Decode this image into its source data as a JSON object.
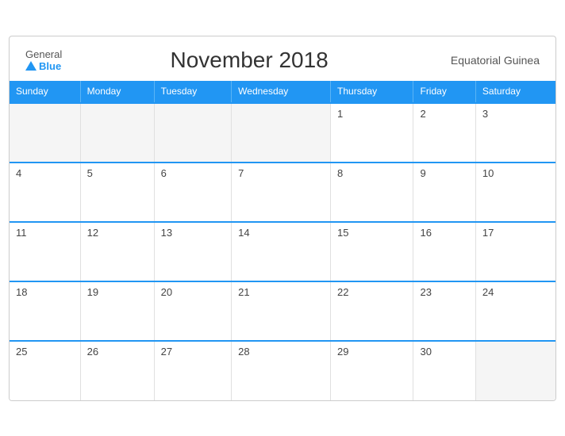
{
  "header": {
    "logo_general": "General",
    "logo_blue": "Blue",
    "title": "November 2018",
    "country": "Equatorial Guinea"
  },
  "days_of_week": [
    "Sunday",
    "Monday",
    "Tuesday",
    "Wednesday",
    "Thursday",
    "Friday",
    "Saturday"
  ],
  "weeks": [
    [
      {
        "day": "",
        "other": true
      },
      {
        "day": "",
        "other": true
      },
      {
        "day": "",
        "other": true
      },
      {
        "day": "",
        "other": true
      },
      {
        "day": "1",
        "other": false
      },
      {
        "day": "2",
        "other": false
      },
      {
        "day": "3",
        "other": false
      }
    ],
    [
      {
        "day": "4",
        "other": false
      },
      {
        "day": "5",
        "other": false
      },
      {
        "day": "6",
        "other": false
      },
      {
        "day": "7",
        "other": false
      },
      {
        "day": "8",
        "other": false
      },
      {
        "day": "9",
        "other": false
      },
      {
        "day": "10",
        "other": false
      }
    ],
    [
      {
        "day": "11",
        "other": false
      },
      {
        "day": "12",
        "other": false
      },
      {
        "day": "13",
        "other": false
      },
      {
        "day": "14",
        "other": false
      },
      {
        "day": "15",
        "other": false
      },
      {
        "day": "16",
        "other": false
      },
      {
        "day": "17",
        "other": false
      }
    ],
    [
      {
        "day": "18",
        "other": false
      },
      {
        "day": "19",
        "other": false
      },
      {
        "day": "20",
        "other": false
      },
      {
        "day": "21",
        "other": false
      },
      {
        "day": "22",
        "other": false
      },
      {
        "day": "23",
        "other": false
      },
      {
        "day": "24",
        "other": false
      }
    ],
    [
      {
        "day": "25",
        "other": false
      },
      {
        "day": "26",
        "other": false
      },
      {
        "day": "27",
        "other": false
      },
      {
        "day": "28",
        "other": false
      },
      {
        "day": "29",
        "other": false
      },
      {
        "day": "30",
        "other": false
      },
      {
        "day": "",
        "other": true
      }
    ]
  ]
}
